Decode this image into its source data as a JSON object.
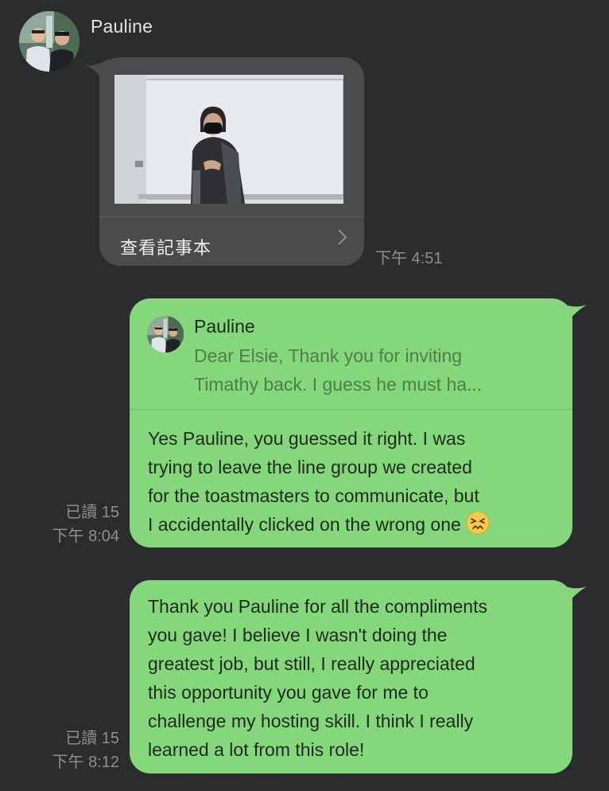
{
  "incoming": {
    "sender_name": "Pauline",
    "note_card": {
      "action_label": "查看記事本"
    },
    "time": "下午 4:51"
  },
  "outgoing": [
    {
      "reply_to": {
        "name": "Pauline",
        "preview_line_1": "Dear Elsie, Thank you for inviting",
        "preview_line_2": "Timathy back. I guess he must ha..."
      },
      "lines": [
        "Yes Pauline, you guessed it right. I was",
        "trying to leave the line group we created",
        "for the toastmasters to communicate, but",
        "I accidentally clicked on the wrong one"
      ],
      "emoji": "confounded-face-emoji",
      "read_status": "已讀 15",
      "time": "下午 8:04"
    },
    {
      "lines": [
        "Thank you Pauline for all the compliments",
        "you gave! I believe I wasn't doing the",
        "greatest job, but still, I really appreciated",
        "this opportunity you gave for me to",
        "challenge my hosting skill. I think I really",
        "learned a lot from this role!"
      ],
      "read_status": "已讀 15",
      "time": "下午 8:12"
    }
  ],
  "colors": {
    "background": "#2b2c2e",
    "incoming_bubble": "#4a4b4d",
    "outgoing_bubble": "#84d77a",
    "meta_text": "#8d8e90"
  }
}
